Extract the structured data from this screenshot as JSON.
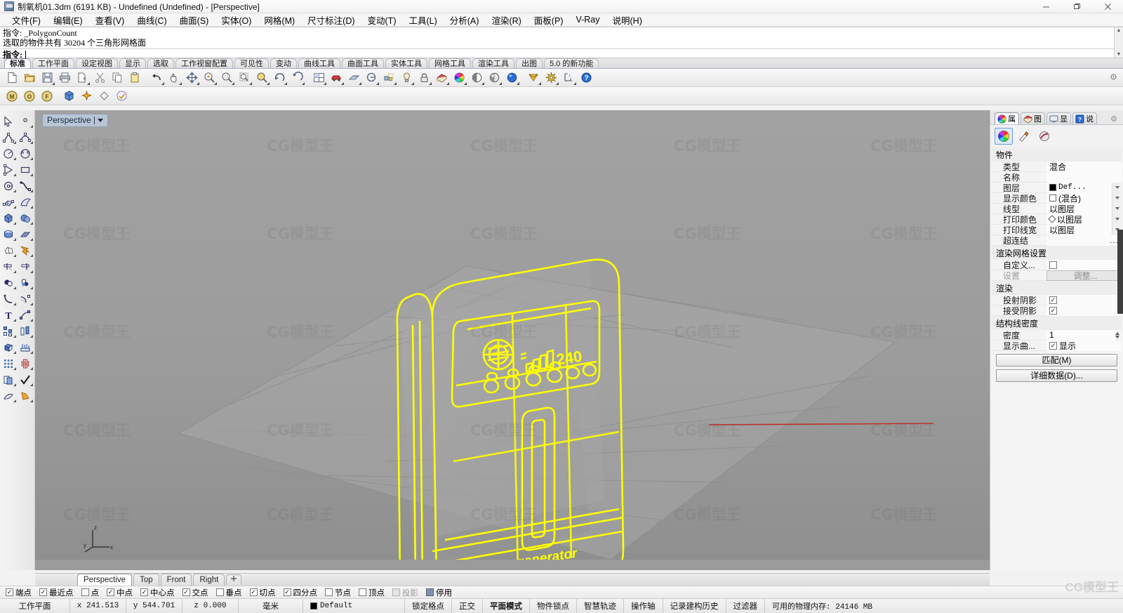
{
  "window": {
    "title": "制氧机01.3dm (6191 KB) - Undefined (Undefined) - [Perspective]",
    "minimize": "—",
    "maximize": "❐",
    "close": "✕"
  },
  "menu": [
    {
      "label": "文件(F)"
    },
    {
      "label": "编辑(E)"
    },
    {
      "label": "查看(V)"
    },
    {
      "label": "曲线(C)"
    },
    {
      "label": "曲面(S)"
    },
    {
      "label": "实体(O)"
    },
    {
      "label": "网格(M)"
    },
    {
      "label": "尺寸标注(D)"
    },
    {
      "label": "变动(T)"
    },
    {
      "label": "工具(L)"
    },
    {
      "label": "分析(A)"
    },
    {
      "label": "渲染(R)"
    },
    {
      "label": "面板(P)"
    },
    {
      "label": "V-Ray"
    },
    {
      "label": "说明(H)"
    }
  ],
  "command": {
    "history_line1": "指令:  _PolygonCount",
    "history_line2": "选取的物件共有 30204 个三角形网格面",
    "prompt_label": "指令:",
    "prompt_value": ""
  },
  "tabstrip": [
    {
      "label": "标准",
      "active": true
    },
    {
      "label": "工作平面",
      "active": false
    },
    {
      "label": "设定视图",
      "active": false
    },
    {
      "label": "显示",
      "active": false
    },
    {
      "label": "选取",
      "active": false
    },
    {
      "label": "工作视窗配置",
      "active": false
    },
    {
      "label": "可见性",
      "active": false
    },
    {
      "label": "变动",
      "active": false
    },
    {
      "label": "曲线工具",
      "active": false
    },
    {
      "label": "曲面工具",
      "active": false
    },
    {
      "label": "实体工具",
      "active": false
    },
    {
      "label": "网格工具",
      "active": false
    },
    {
      "label": "渲染工具",
      "active": false
    },
    {
      "label": "出图",
      "active": false
    },
    {
      "label": "5.0 的新功能",
      "active": false
    }
  ],
  "viewport": {
    "name": "Perspective",
    "tabs": [
      {
        "label": "Perspective",
        "active": true
      },
      {
        "label": "Top",
        "active": false
      },
      {
        "label": "Front",
        "active": false
      },
      {
        "label": "Right",
        "active": false
      }
    ],
    "axis": {
      "z": "z",
      "y": "y",
      "x": "x"
    },
    "model_label": "Oxygenerator",
    "model_display_value": "240"
  },
  "properties": {
    "tabs": [
      {
        "label": "属",
        "icon": "color-wheel-icon",
        "active": true
      },
      {
        "label": "图",
        "icon": "layer-icon",
        "active": false
      },
      {
        "label": "显",
        "icon": "display-icon",
        "active": false
      },
      {
        "label": "说",
        "icon": "help-icon",
        "active": false
      }
    ],
    "sections": [
      {
        "title": "物件",
        "rows": [
          {
            "label": "类型",
            "value": "混合",
            "kind": "text"
          },
          {
            "label": "名称",
            "value": "",
            "kind": "text"
          },
          {
            "label": "图层",
            "value": "Def...",
            "kind": "swatch-black-dropdown"
          },
          {
            "label": "显示颜色",
            "value": "(混合)",
            "kind": "swatch-white-dropdown"
          },
          {
            "label": "线型",
            "value": "以图层",
            "kind": "dropdown"
          },
          {
            "label": "打印颜色",
            "value": "以图层",
            "kind": "diamond-dropdown"
          },
          {
            "label": "打印线宽",
            "value": "以图层",
            "kind": "dropdown"
          },
          {
            "label": "超连结",
            "value": "",
            "kind": "dots"
          }
        ]
      },
      {
        "title": "渲染网格设置",
        "rows": [
          {
            "label": "自定义...",
            "value": "",
            "kind": "checkbox",
            "checked": false
          },
          {
            "label": "设置",
            "value": "调整...",
            "kind": "button",
            "dim": true
          }
        ]
      },
      {
        "title": "渲染",
        "rows": [
          {
            "label": "投射阴影",
            "value": "",
            "kind": "checkbox",
            "checked": true
          },
          {
            "label": "接受阴影",
            "value": "",
            "kind": "checkbox",
            "checked": true
          }
        ]
      },
      {
        "title": "结构线密度",
        "rows": [
          {
            "label": "密度",
            "value": "1",
            "kind": "spinner"
          },
          {
            "label": "显示曲...",
            "value": "显示",
            "kind": "checkbox-label",
            "checked": true
          }
        ]
      }
    ],
    "buttons": [
      {
        "label": "匹配(M)"
      },
      {
        "label": "详细数据(D)..."
      }
    ]
  },
  "osnap": [
    {
      "label": "端点",
      "checked": true
    },
    {
      "label": "最近点",
      "checked": true
    },
    {
      "label": "点",
      "checked": false
    },
    {
      "label": "中点",
      "checked": true
    },
    {
      "label": "中心点",
      "checked": true
    },
    {
      "label": "交点",
      "checked": true
    },
    {
      "label": "垂点",
      "checked": false
    },
    {
      "label": "切点",
      "checked": true
    },
    {
      "label": "四分点",
      "checked": true
    },
    {
      "label": "节点",
      "checked": false
    },
    {
      "label": "顶点",
      "checked": false
    },
    {
      "label": "投影",
      "checked": false,
      "state": "gray"
    },
    {
      "label": "停用",
      "checked": false,
      "state": "blue"
    }
  ],
  "statusbar": {
    "cplane": "工作平面",
    "x": "x 241.513",
    "y": "y 544.701",
    "z": "z 0.000",
    "units": "毫米",
    "layer": "Default",
    "snap": "锁定格点",
    "ortho": "正交",
    "planar": "平面模式",
    "osnap": "物件锁点",
    "smarttrack": "智慧轨迹",
    "gumball": "操作轴",
    "history": "记录建构历史",
    "filter": "过滤器",
    "memory": "可用的物理内存: 24146 MB"
  },
  "watermark": {
    "text": "CG模型王",
    "corner": "CG模型王"
  }
}
